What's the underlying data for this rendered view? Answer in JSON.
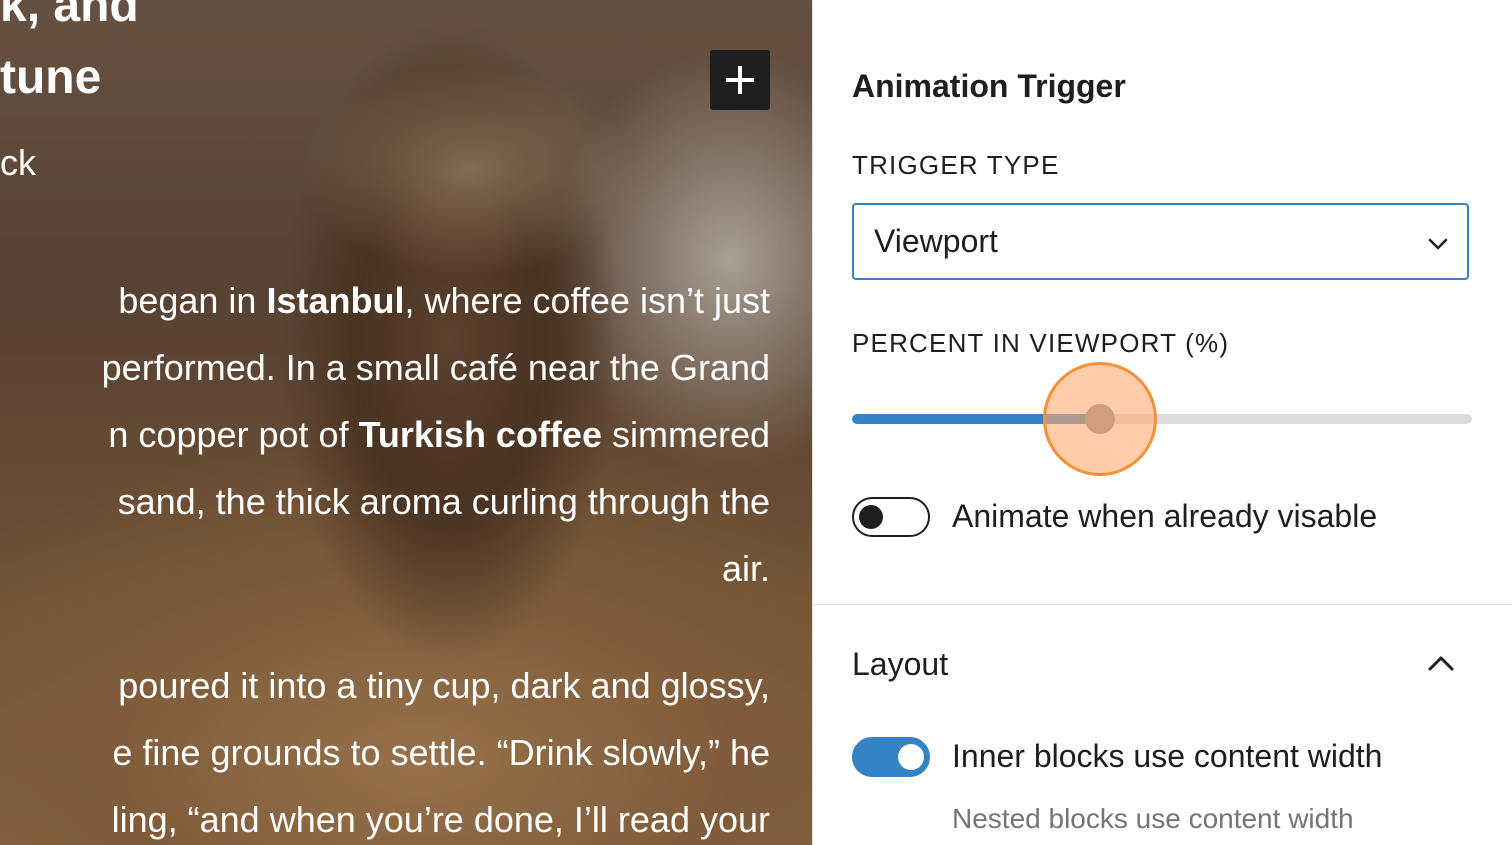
{
  "canvas": {
    "heading_line1": "k, and",
    "heading_line2": "tune",
    "byline": "ck",
    "paragraph1_lines": [
      [
        "began in ",
        "Istanbul",
        ", where coffee isn’t just"
      ],
      [
        "performed. In a small café near the Grand"
      ],
      [
        "n copper pot of ",
        "Turkish coffee",
        " simmered"
      ],
      [
        "sand, the thick aroma curling through the"
      ],
      [
        "air."
      ]
    ],
    "paragraph2_lines": [
      "poured it into a tiny cup, dark and glossy,",
      "e fine grounds to settle. “Drink slowly,” he",
      "ling, “and when you’re done, I’ll read your"
    ],
    "add_block_icon": "plus-icon"
  },
  "sidebar": {
    "animation_trigger": {
      "title": "Animation Trigger",
      "trigger_type_label": "TRIGGER TYPE",
      "trigger_type_value": "Viewport",
      "percent_label": "PERCENT IN VIEWPORT (%)",
      "percent_value": 40,
      "percent_max": 100,
      "animate_visible_label": "Animate when already visable",
      "animate_visible_on": false
    },
    "layout": {
      "title": "Layout",
      "expanded": true,
      "inner_blocks_label": "Inner blocks use content width",
      "inner_blocks_on": true,
      "inner_blocks_help": "Nested blocks use content width"
    }
  },
  "colors": {
    "accent": "#3582c4",
    "text": "#1e1e1e",
    "muted": "#757575",
    "cursor_highlight": "#f3913b"
  }
}
